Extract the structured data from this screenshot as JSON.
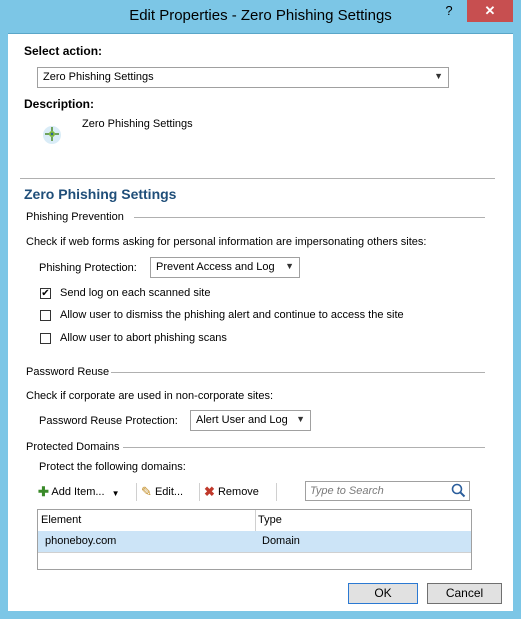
{
  "window": {
    "title": "Edit Properties - Zero Phishing Settings",
    "help_label": "?",
    "close_label": "✕"
  },
  "select_action": {
    "label": "Select action:",
    "value": "Zero Phishing Settings"
  },
  "description": {
    "label": "Description:",
    "text": "Zero Phishing Settings"
  },
  "section_title": "Zero Phishing Settings",
  "phishing_prevention": {
    "group_label": "Phishing Prevention",
    "intro": "Check if web forms asking for personal information are impersonating others sites:",
    "protection_label": "Phishing Protection:",
    "protection_value": "Prevent Access and Log",
    "checkboxes": [
      {
        "label": "Send log on each scanned site",
        "checked": true
      },
      {
        "label": "Allow user to dismiss the phishing alert and continue to access the site",
        "checked": false
      },
      {
        "label": "Allow user to abort phishing scans",
        "checked": false
      }
    ]
  },
  "password_reuse": {
    "group_label": "Password Reuse",
    "intro": "Check if corporate are used in non-corporate sites:",
    "protection_label": "Password Reuse Protection:",
    "protection_value": "Alert User and Log"
  },
  "protected_domains": {
    "group_label": "Protected Domains",
    "intro": "Protect the following domains:",
    "toolbar": {
      "add_label": "Add Item...",
      "edit_label": "Edit...",
      "remove_label": "Remove",
      "search_placeholder": "Type to Search"
    },
    "columns": [
      "Element",
      "Type"
    ],
    "rows": [
      {
        "element": "phoneboy.com",
        "type": "Domain"
      }
    ]
  },
  "buttons": {
    "ok": "OK",
    "cancel": "Cancel"
  },
  "colors": {
    "titlebar": "#7cc6e6",
    "close": "#c74f50",
    "section_title": "#1f4e79",
    "selected_row": "#cce4f7"
  }
}
